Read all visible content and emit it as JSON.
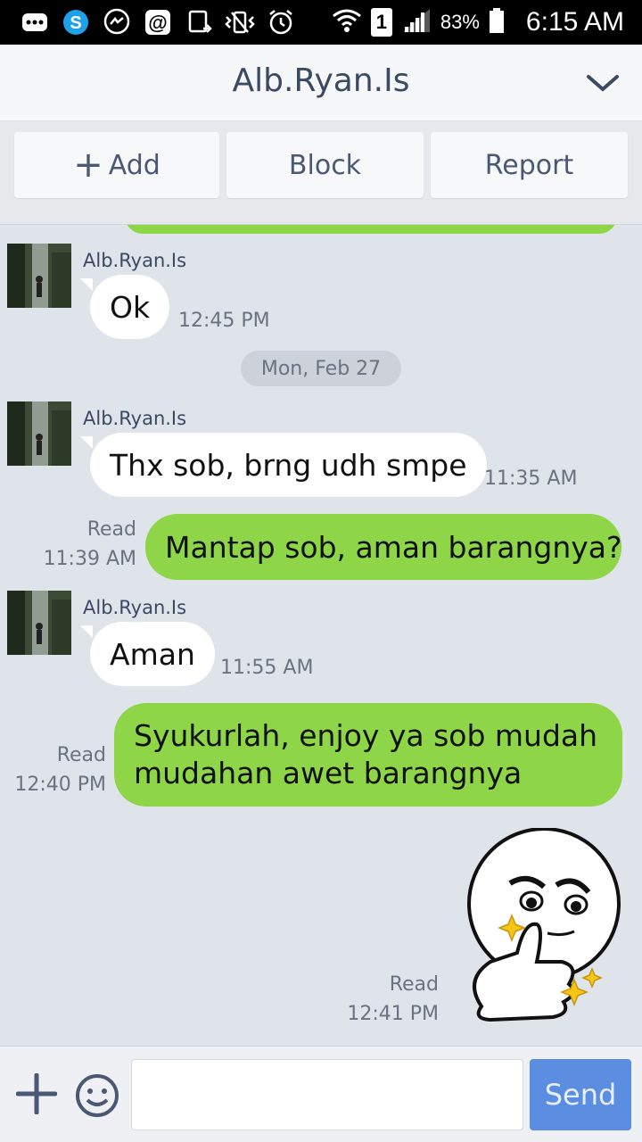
{
  "status_bar": {
    "battery": "83%",
    "time": "6:15 AM",
    "sim_badge": "1",
    "icons": [
      "more-icon",
      "skype-icon",
      "messenger-icon",
      "at-icon",
      "cast-icon",
      "vibrate-icon",
      "alarm-icon",
      "wifi-icon",
      "signal-icon",
      "battery-icon"
    ]
  },
  "header": {
    "title": "Alb.Ryan.Is"
  },
  "actions": {
    "add": "Add",
    "block": "Block",
    "report": "Report"
  },
  "messages": [
    {
      "sender": "Alb.Ryan.Is",
      "text": "Ok",
      "time": "12:45 PM"
    },
    {
      "date": "Mon, Feb 27"
    },
    {
      "sender": "Alb.Ryan.Is",
      "text": "Thx sob, brng udh smpe",
      "time": "11:35 AM"
    },
    {
      "read": "Read",
      "text": "Mantap sob, aman barangnya?",
      "time": "11:39 AM"
    },
    {
      "sender": "Alb.Ryan.Is",
      "text": "Aman",
      "time": "11:55 AM"
    },
    {
      "read": "Read",
      "text_lines": [
        "Syukurlah, enjoy ya sob mudah",
        "mudahan awet barangnya"
      ],
      "time": "12:40 PM"
    },
    {
      "read": "Read",
      "sticker": "thumbs-up-sticker",
      "time": "12:41 PM"
    }
  ],
  "input": {
    "placeholder": "",
    "send_label": "Send"
  },
  "colors": {
    "accent_green": "#8ed548",
    "send_blue": "#5b8de0",
    "background": "#dfe3ea"
  }
}
